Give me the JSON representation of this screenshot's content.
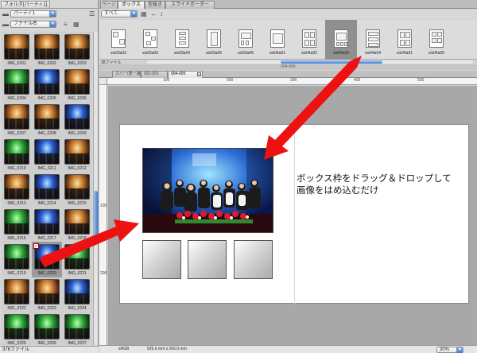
{
  "left_panel": {
    "tab_label": "フォルダ[パーティ1]",
    "folder_select": "パーティ1",
    "sort_select": "ファイル名",
    "thumbnails": [
      {
        "label": "IMG_0201",
        "tone": "warm"
      },
      {
        "label": "IMG_0202",
        "tone": "warm"
      },
      {
        "label": "IMG_0203",
        "tone": "warm"
      },
      {
        "label": "IMG_0204",
        "tone": "green"
      },
      {
        "label": "IMG_0205",
        "tone": "blue"
      },
      {
        "label": "IMG_0206",
        "tone": "warm"
      },
      {
        "label": "IMG_0207",
        "tone": "warm"
      },
      {
        "label": "IMG_0208",
        "tone": "warm"
      },
      {
        "label": "IMG_0209",
        "tone": "blue"
      },
      {
        "label": "IMG_0210",
        "tone": "green"
      },
      {
        "label": "IMG_0211",
        "tone": "blue"
      },
      {
        "label": "IMG_0212",
        "tone": "warm"
      },
      {
        "label": "IMG_0213",
        "tone": "warm"
      },
      {
        "label": "IMG_0214",
        "tone": "blue"
      },
      {
        "label": "IMG_0215",
        "tone": "warm"
      },
      {
        "label": "IMG_0216",
        "tone": "green"
      },
      {
        "label": "IMG_0217",
        "tone": "blue"
      },
      {
        "label": "IMG_0218",
        "tone": "warm"
      },
      {
        "label": "IMG_0219",
        "tone": "green"
      },
      {
        "label": "IMG_0220",
        "tone": "blue",
        "selected": true
      },
      {
        "label": "IMG_0221",
        "tone": "green"
      },
      {
        "label": "IMG_0222",
        "tone": "warm"
      },
      {
        "label": "IMG_0223",
        "tone": "warm"
      },
      {
        "label": "IMG_0224",
        "tone": "blue"
      },
      {
        "label": "IMG_0225",
        "tone": "green"
      },
      {
        "label": "IMG_0226",
        "tone": "green"
      },
      {
        "label": "IMG_0227",
        "tone": "green"
      }
    ],
    "file_count": "376ファイル"
  },
  "top_tabs": [
    {
      "label": "ページ",
      "active": false
    },
    {
      "label": "ボックス",
      "active": true
    },
    {
      "label": "型抜き",
      "active": false
    },
    {
      "label": "スライドボーダー",
      "active": false
    }
  ],
  "library": {
    "filter_select": "すべて",
    "items": [
      {
        "label": "sis03a02",
        "layout": "a02"
      },
      {
        "label": "sis03a03",
        "layout": "a03"
      },
      {
        "label": "sis03a04",
        "layout": "a04"
      },
      {
        "label": "sis03a05",
        "layout": "a05"
      },
      {
        "label": "sis03a06",
        "layout": "a06"
      },
      {
        "label": "sis04a01",
        "layout": "b01"
      },
      {
        "label": "sis04a02",
        "layout": "b02"
      },
      {
        "label": "sis04a03",
        "layout": "b03",
        "selected": true
      },
      {
        "label": "sis04a04",
        "layout": "b04"
      },
      {
        "label": "sis04a01",
        "layout": "b05"
      },
      {
        "label": "sis04a05",
        "layout": "b06"
      }
    ],
    "file_count": "38ファイル",
    "section_title": "004-005"
  },
  "doc_tabs": [
    {
      "label": "カバー(表ー裏)",
      "active": false
    },
    {
      "label": "002-003",
      "active": false
    },
    {
      "label": "004-005",
      "active": true
    }
  ],
  "rulers": {
    "top": [
      "100",
      "200",
      "300",
      "400",
      "500"
    ],
    "left": [
      "100",
      "200"
    ]
  },
  "page": {
    "caption_line1": "ボックス枠をドラッグ＆ドロップして",
    "caption_line2": "画像をはめ込むだけ"
  },
  "status": {
    "color_mode": "sRGB",
    "page_size": "526.0 mm x 266.0 mm",
    "zoom": "30%"
  },
  "colors": {
    "arrow": "#ee1111",
    "selection_blue": "#3f7ad3"
  }
}
